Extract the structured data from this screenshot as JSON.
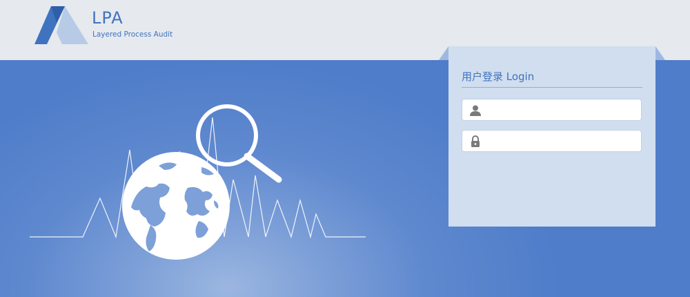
{
  "brand": {
    "name": "LPA",
    "tagline": "Layered Process Audit",
    "colors": {
      "primary": "#3f73bf",
      "light": "#b7cbe6"
    }
  },
  "login": {
    "title": "用户登录 Login",
    "username": {
      "value": "",
      "placeholder": "",
      "icon": "user-icon"
    },
    "password": {
      "value": "",
      "placeholder": "",
      "icon": "lock-icon"
    }
  },
  "illustration": {
    "icons": [
      "globe-icon",
      "magnifier-icon",
      "pulse-line"
    ]
  },
  "colors": {
    "header_bg": "#e6e9ee",
    "banner_bg": "#5584cc",
    "panel_bg": "#d0deef",
    "accent": "#3f73bf"
  }
}
